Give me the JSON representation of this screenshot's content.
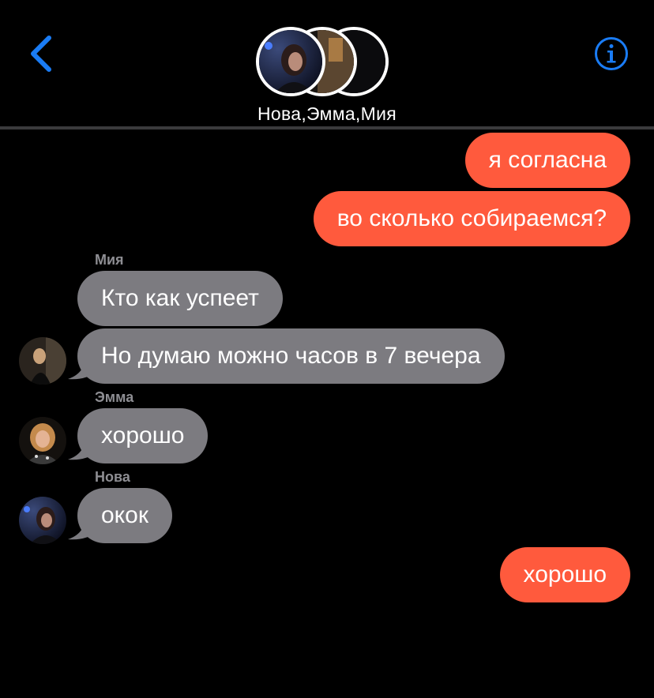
{
  "header": {
    "chat_title": "Нова,Эмма,Мия",
    "back_icon": "chevron-left-icon",
    "info_icon": "info-icon",
    "accent_color": "#1a7cf5"
  },
  "messages": [
    {
      "direction": "out",
      "text": "я согласна"
    },
    {
      "direction": "out",
      "text": "во сколько собираемся?"
    },
    {
      "direction": "in",
      "sender": "Мия",
      "text": "Кто как успеет"
    },
    {
      "direction": "in",
      "text": "Но думаю можно часов в 7 вечера"
    },
    {
      "direction": "in",
      "sender": "Эмма",
      "text": "хорошо"
    },
    {
      "direction": "in",
      "sender": "Нова",
      "text": "окок"
    },
    {
      "direction": "out",
      "text": "хорошо"
    }
  ],
  "colors": {
    "outgoing_bubble": "#ff5a3d",
    "incoming_bubble": "#7c7b80",
    "background": "#000000",
    "sender_name": "#8e8e93"
  }
}
